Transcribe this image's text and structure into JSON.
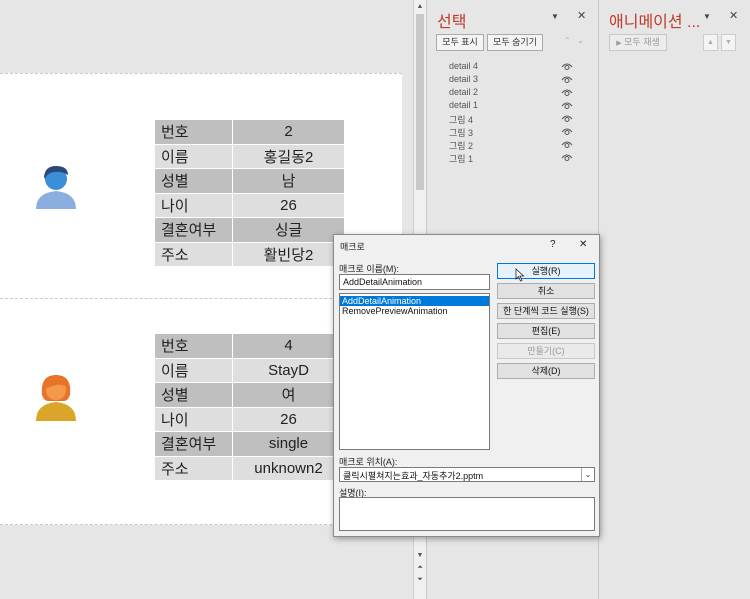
{
  "slides": [
    {
      "person": "male",
      "rows": [
        {
          "key": "번호",
          "value": "2"
        },
        {
          "key": "이름",
          "value": "홍길동2"
        },
        {
          "key": "성별",
          "value": "남"
        },
        {
          "key": "나이",
          "value": "26"
        },
        {
          "key": "결혼여부",
          "value": "싱글"
        },
        {
          "key": "주소",
          "value": "활빈당2"
        }
      ]
    },
    {
      "person": "female",
      "rows": [
        {
          "key": "번호",
          "value": "4"
        },
        {
          "key": "이름",
          "value": "StayD"
        },
        {
          "key": "성별",
          "value": "여"
        },
        {
          "key": "나이",
          "value": "26"
        },
        {
          "key": "결혼여부",
          "value": "single"
        },
        {
          "key": "주소",
          "value": "unknown2"
        }
      ]
    }
  ],
  "selection_pane": {
    "title": "선택",
    "show_all": "모두 표시",
    "hide_all": "모두 숨기기",
    "items": [
      "detail 4",
      "detail 3",
      "detail 2",
      "detail 1",
      "그림 4",
      "그림 3",
      "그림 2",
      "그림 1"
    ]
  },
  "animation_pane": {
    "title": "애니메이션 ...",
    "play_all": "모두 재생"
  },
  "macro_dialog": {
    "title": "매크로",
    "help": "?",
    "close": "✕",
    "name_label": "매크로 이름(M):",
    "name_value": "AddDetailAnimation",
    "macros": [
      "AddDetailAnimation",
      "RemovePreviewAnimation"
    ],
    "selected_index": 0,
    "buttons": {
      "run": "실행(R)",
      "cancel": "취소",
      "step": "한 단계씩 코드 실행(S)",
      "edit": "편집(E)",
      "create": "만들기(C)",
      "delete": "삭제(D)"
    },
    "location_label": "매크로 위치(A):",
    "location_value": "클릭시펼쳐지는효과_자동추가2.pptm",
    "description_label": "설명(I):",
    "description_value": ""
  },
  "colors": {
    "pane_title": "#c0392b",
    "selected_item": "#0078d7",
    "male_skin": "#3a8fd6",
    "male_hair": "#2b4a7a",
    "male_body": "#8aaee0",
    "female_skin": "#f2994a",
    "female_hair": "#e8742a",
    "female_body": "#d9a62a"
  }
}
